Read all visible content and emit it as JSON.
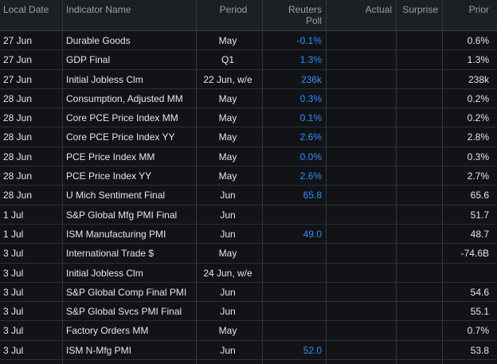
{
  "header": {
    "local_date": "Local Date",
    "indicator_name": "Indicator Name",
    "period": "Period",
    "reuters_poll_line1": "Reuters",
    "reuters_poll_line2": "Poll",
    "actual": "Actual",
    "surprise": "Surprise",
    "prior": "Prior"
  },
  "rows": [
    {
      "date": "27 Jun",
      "name": "Durable Goods",
      "period": "May",
      "poll": "-0.1%",
      "actual": "",
      "surprise": "",
      "prior": "0.6%"
    },
    {
      "date": "27 Jun",
      "name": "GDP Final",
      "period": "Q1",
      "poll": "1.3%",
      "actual": "",
      "surprise": "",
      "prior": "1.3%"
    },
    {
      "date": "27 Jun",
      "name": "Initial Jobless Clm",
      "period": "22 Jun, w/e",
      "poll": "236k",
      "actual": "",
      "surprise": "",
      "prior": "238k"
    },
    {
      "date": "28 Jun",
      "name": "Consumption, Adjusted MM",
      "period": "May",
      "poll": "0.3%",
      "actual": "",
      "surprise": "",
      "prior": "0.2%"
    },
    {
      "date": "28 Jun",
      "name": "Core PCE Price Index MM",
      "period": "May",
      "poll": "0.1%",
      "actual": "",
      "surprise": "",
      "prior": "0.2%"
    },
    {
      "date": "28 Jun",
      "name": "Core PCE Price Index YY",
      "period": "May",
      "poll": "2.6%",
      "actual": "",
      "surprise": "",
      "prior": "2.8%"
    },
    {
      "date": "28 Jun",
      "name": "PCE Price Index MM",
      "period": "May",
      "poll": "0.0%",
      "actual": "",
      "surprise": "",
      "prior": "0.3%"
    },
    {
      "date": "28 Jun",
      "name": "PCE Price Index YY",
      "period": "May",
      "poll": "2.6%",
      "actual": "",
      "surprise": "",
      "prior": "2.7%"
    },
    {
      "date": "28 Jun",
      "name": "U Mich Sentiment Final",
      "period": "Jun",
      "poll": "65.8",
      "actual": "",
      "surprise": "",
      "prior": "65.6"
    },
    {
      "date": "1 Jul",
      "name": "S&P Global Mfg PMI Final",
      "period": "Jun",
      "poll": "",
      "actual": "",
      "surprise": "",
      "prior": "51.7"
    },
    {
      "date": "1 Jul",
      "name": "ISM Manufacturing PMI",
      "period": "Jun",
      "poll": "49.0",
      "actual": "",
      "surprise": "",
      "prior": "48.7"
    },
    {
      "date": "3 Jul",
      "name": "International Trade $",
      "period": "May",
      "poll": "",
      "actual": "",
      "surprise": "",
      "prior": "-74.6B"
    },
    {
      "date": "3 Jul",
      "name": "Initial Jobless Clm",
      "period": "24 Jun, w/e",
      "poll": "",
      "actual": "",
      "surprise": "",
      "prior": ""
    },
    {
      "date": "3 Jul",
      "name": "S&P Global Comp Final PMI",
      "period": "Jun",
      "poll": "",
      "actual": "",
      "surprise": "",
      "prior": "54.6"
    },
    {
      "date": "3 Jul",
      "name": "S&P Global Svcs PMI Final",
      "period": "Jun",
      "poll": "",
      "actual": "",
      "surprise": "",
      "prior": "55.1"
    },
    {
      "date": "3 Jul",
      "name": "Factory Orders MM",
      "period": "May",
      "poll": "",
      "actual": "",
      "surprise": "",
      "prior": "0.7%"
    },
    {
      "date": "3 Jul",
      "name": "ISM N-Mfg PMI",
      "period": "Jun",
      "poll": "52.0",
      "actual": "",
      "surprise": "",
      "prior": "53.8"
    }
  ],
  "colors": {
    "background": "#111316",
    "header_background": "#1c1f24",
    "header_text": "#9aa0a6",
    "body_text": "#e6e6e6",
    "poll_text": "#2f8fff",
    "grid_line": "#2c2f34"
  }
}
